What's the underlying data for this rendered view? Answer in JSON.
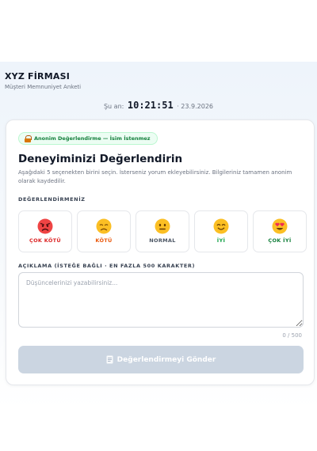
{
  "header": {
    "company": "XYZ FİRMASI",
    "subtitle": "Müşteri Memnuniyet Anketi"
  },
  "clock": {
    "prefix": "Şu an:",
    "time": "10:21:51",
    "date": "· 23.9.2026"
  },
  "card": {
    "badge": "Anonim Değerlendirme — İsim İstenmez",
    "title": "Deneyiminizi Değerlendirin",
    "description": "Aşağıdaki 5 seçenekten birini seçin. İsterseniz yorum ekleyebilirsiniz. Bilgileriniz tamamen anonim olarak kaydedilir.",
    "rating_section_label": "DEĞERLENDİRMENİZ",
    "ratings": [
      {
        "label": "ÇOK KÖTÜ",
        "icon": "angry-face-icon",
        "color": "#dc2626"
      },
      {
        "label": "KÖTÜ",
        "icon": "sad-face-icon",
        "color": "#ea580c"
      },
      {
        "label": "NORMAL",
        "icon": "neutral-face-icon",
        "color": "#4b5563"
      },
      {
        "label": "İYİ",
        "icon": "smiling-face-icon",
        "color": "#16a34a"
      },
      {
        "label": "ÇOK İYİ",
        "icon": "heart-eyes-face-icon",
        "color": "#15803d"
      }
    ],
    "comment_section_label": "AÇIKLAMA (İSTEĞE BAĞLI · EN FAZLA 500 KARAKTER)",
    "comment": {
      "value": "",
      "placeholder": "Düşüncelerinizi yazabilirsiniz..."
    },
    "counter": "0 / 500",
    "submit_label": "Değerlendirmeyi Gönder"
  },
  "colors": {
    "badge_text": "#15803d",
    "badge_bg": "#ecfdf3",
    "submit_disabled": "#cbd5e1"
  }
}
